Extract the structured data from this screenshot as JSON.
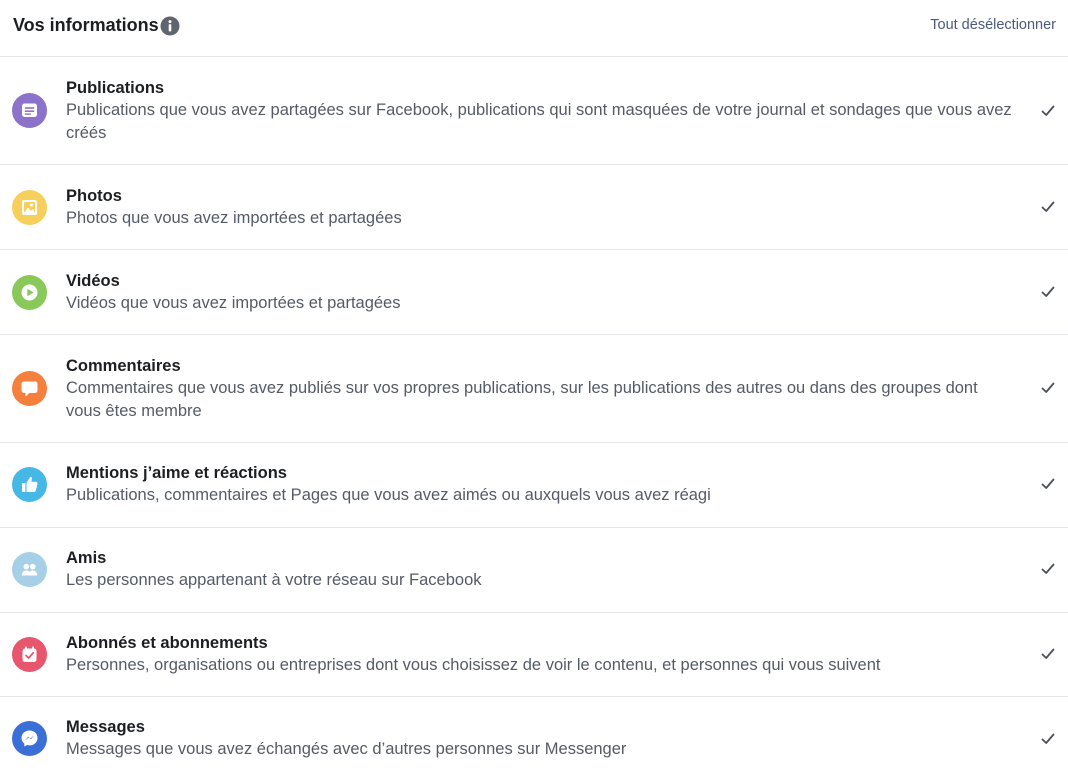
{
  "header": {
    "title": "Vos informations",
    "info_icon": "info-icon",
    "deselect_label": "Tout désélectionner"
  },
  "items": [
    {
      "title": "Publications",
      "description": "Publications que vous avez partagées sur Facebook, publications qui sont masquées de votre journal et sondages que vous avez créés",
      "icon": "posts-icon",
      "color": "#8c72cb",
      "checked": true
    },
    {
      "title": "Photos",
      "description": "Photos que vous avez importées et partagées",
      "icon": "photos-icon",
      "color": "#f7cf5c",
      "checked": true
    },
    {
      "title": "Vidéos",
      "description": "Vidéos que vous avez importées et partagées",
      "icon": "videos-icon",
      "color": "#89c95a",
      "checked": true
    },
    {
      "title": "Commentaires",
      "description": "Commentaires que vous avez publiés sur vos propres publications, sur les publications des autres ou dans des groupes dont vous êtes membre",
      "icon": "comments-icon",
      "color": "#f5803e",
      "checked": true
    },
    {
      "title": "Mentions j’aime et réactions",
      "description": "Publications, commentaires et Pages que vous avez aimés ou auxquels vous avez réagi",
      "icon": "likes-icon",
      "color": "#45b8e6",
      "checked": true
    },
    {
      "title": "Amis",
      "description": "Les personnes appartenant à votre réseau sur Facebook",
      "icon": "friends-icon",
      "color": "#a6cfe8",
      "checked": true
    },
    {
      "title": "Abonnés et abonnements",
      "description": "Personnes, organisations ou entreprises dont vous choisissez de voir le contenu, et personnes qui vous suivent",
      "icon": "followers-icon",
      "color": "#e8566e",
      "checked": true
    },
    {
      "title": "Messages",
      "description": "Messages que vous avez échangés avec d’autres personnes sur Messenger",
      "icon": "messenger-icon",
      "color": "#3b6fd8",
      "checked": true
    }
  ]
}
